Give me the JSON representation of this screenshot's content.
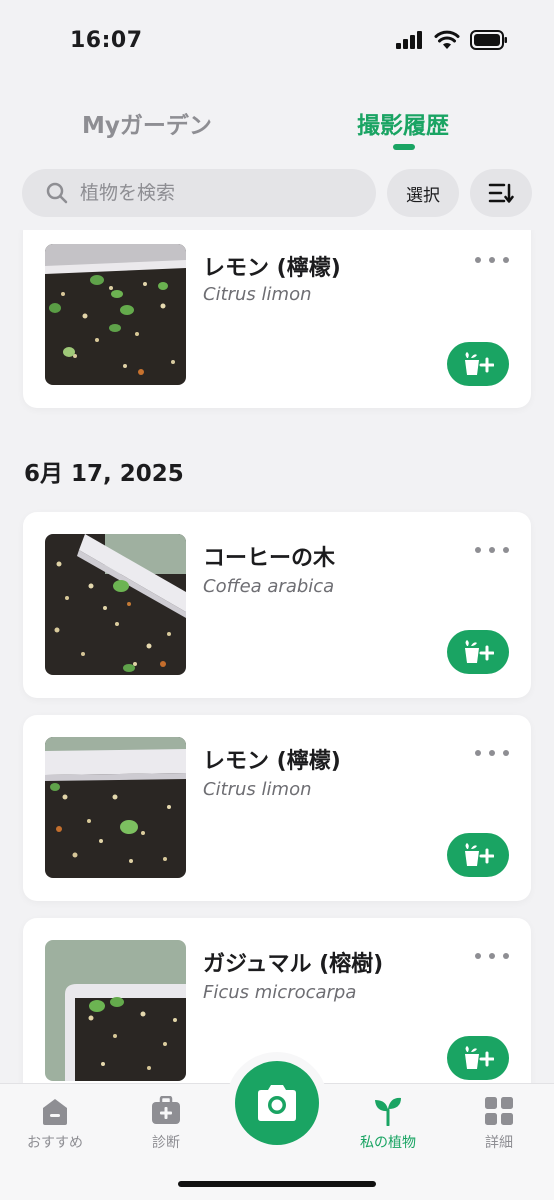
{
  "status": {
    "time": "16:07"
  },
  "tabs": {
    "garden": "Myガーデン",
    "history": "撮影履歴"
  },
  "search": {
    "placeholder": "植物を検索",
    "value": ""
  },
  "toolbar": {
    "select_label": "選択"
  },
  "date_group": "6月 17, 2025",
  "cards": [
    {
      "name": "レモン (檸檬)",
      "scientific": "Citrus limon"
    },
    {
      "name": "コーヒーの木",
      "scientific": "Coffea arabica"
    },
    {
      "name": "レモン (檸檬)",
      "scientific": "Citrus limon"
    },
    {
      "name": "ガジュマル (榕樹)",
      "scientific": "Ficus microcarpa"
    }
  ],
  "bottom_nav": {
    "recommend": "おすすめ",
    "diagnose": "診断",
    "my_plants": "私の植物",
    "details": "詳細"
  },
  "colors": {
    "accent": "#1aa463",
    "background": "#f2f2f4",
    "card": "#ffffff"
  },
  "icons": [
    "search-icon",
    "sort-icon",
    "more-icon",
    "add-to-garden-icon",
    "home-icon",
    "medkit-icon",
    "camera-icon",
    "sprout-icon",
    "grid-icon"
  ]
}
